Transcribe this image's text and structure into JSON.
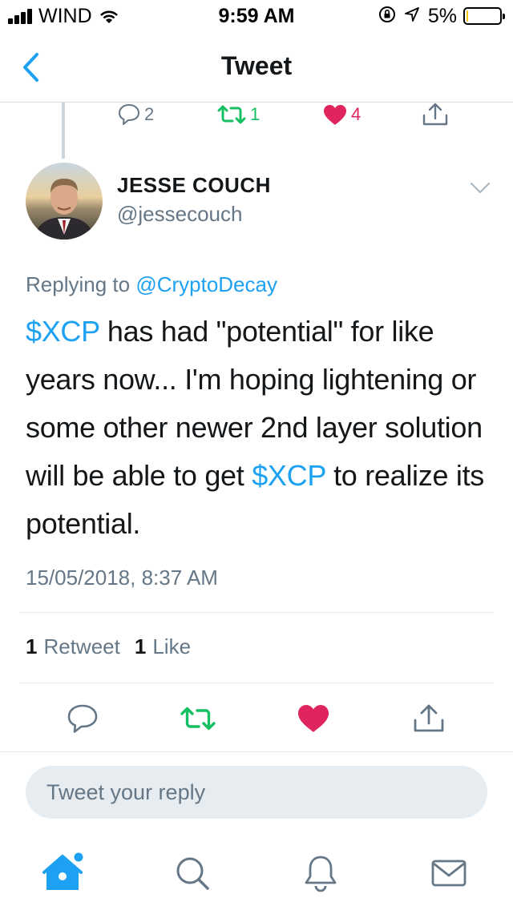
{
  "status_bar": {
    "carrier": "WIND",
    "time": "9:59 AM",
    "battery_percent_label": "5%",
    "battery_level": 0.05,
    "icons": [
      "signal-icon",
      "wifi-icon",
      "orientation-lock-icon",
      "location-arrow-icon",
      "battery-icon"
    ]
  },
  "nav": {
    "title": "Tweet",
    "back_icon": "chevron-left-icon"
  },
  "previous_tweet_actions": {
    "reply_count": "2",
    "retweet_count": "1",
    "like_count": "4"
  },
  "tweet": {
    "author_name": "JESSE COUCH",
    "author_handle": "@jessecouch",
    "replying_prefix": "Replying to",
    "replying_to": "@CryptoDecay",
    "text_segments": [
      {
        "text": "$XCP",
        "link": true
      },
      {
        "text": " has had \"potential\" for like years now... I'm hoping lightening or some other newer 2nd layer solution will be able to get ",
        "link": false
      },
      {
        "text": "$XCP",
        "link": true
      },
      {
        "text": " to realize its potential.",
        "link": false
      }
    ],
    "timestamp": "15/05/2018, 8:37 AM",
    "retweet_count": "1",
    "retweet_label": "Retweet",
    "like_count": "1",
    "like_label": "Like"
  },
  "reply": {
    "placeholder": "Tweet your reply"
  },
  "tab_bar": {
    "items": [
      "home-icon",
      "search-icon",
      "notifications-icon",
      "messages-icon"
    ]
  },
  "colors": {
    "accent": "#1da1f2",
    "retweet": "#17bf63",
    "like": "#e0245e",
    "secondary_text": "#657786",
    "reply_box_bg": "#e6ecf0"
  }
}
